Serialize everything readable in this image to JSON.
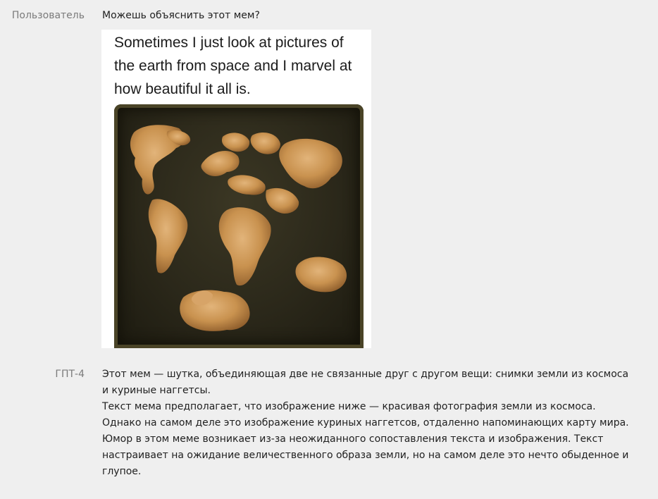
{
  "conversation": [
    {
      "speaker": "Пользователь",
      "text": "Можешь объяснить этот мем?",
      "image": {
        "caption": "Sometimes I just look at pictures of the earth from space and I marvel at how beautiful it all is.",
        "subject": "chicken nuggets on a baking tray arranged like a world map"
      }
    },
    {
      "speaker": "ГПТ-4",
      "paragraphs": [
        "Этот мем — шутка, объединяющая две не связанные друг с другом вещи: снимки земли из космоса и куриные наггетсы.",
        "Текст мема предполагает, что изображение ниже — красивая фотография земли из космоса. Однако на самом деле это изображение куриных наггетсов, отдаленно напоминающих карту мира.",
        "Юмор в этом меме возникает из-за неожиданного сопоставления текста и изображения. Текст настраивает на ожидание величественного образа земли, но на самом деле это нечто обыденное и глупое."
      ]
    }
  ],
  "colors": {
    "background": "#efefef",
    "speaker_label": "#7a7a7a",
    "text": "#1f1f1f",
    "tray": "#2b281a",
    "nugget": "#c9924f"
  }
}
